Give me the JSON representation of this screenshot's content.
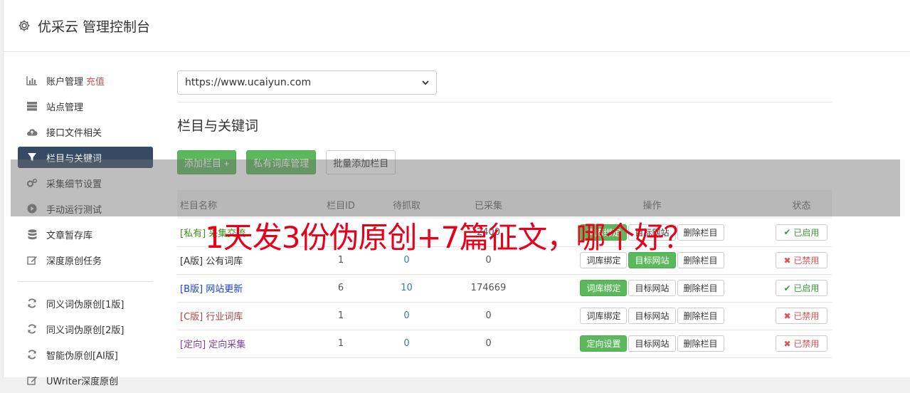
{
  "header": {
    "title": "优采云 管理控制台"
  },
  "sidebar": {
    "items": [
      {
        "label": "账户管理",
        "extra": "充值",
        "icon": "bar-chart-icon"
      },
      {
        "label": "站点管理",
        "icon": "server-icon"
      },
      {
        "label": "接口文件相关",
        "icon": "cloud-upload-icon"
      },
      {
        "label": "栏目与关键词",
        "icon": "filter-icon",
        "active": true
      },
      {
        "label": "采集细节设置",
        "icon": "cogs-icon"
      },
      {
        "label": "手动运行测试",
        "icon": "play-icon"
      },
      {
        "label": "文章暂存库",
        "icon": "database-icon"
      },
      {
        "label": "深度原创任务",
        "icon": "edit-icon"
      }
    ],
    "items2": [
      {
        "label": "同义词伪原创[1版]",
        "icon": "refresh-icon"
      },
      {
        "label": "同义词伪原创[2版]",
        "icon": "refresh-icon"
      },
      {
        "label": "智能伪原创[AI版]",
        "icon": "refresh-icon"
      },
      {
        "label": "UWriter深度原创",
        "icon": "edit-icon"
      }
    ]
  },
  "main": {
    "site_select": "https://www.ucaiyun.com",
    "section_title": "栏目与关键词",
    "buttons": {
      "add": "添加栏目 +",
      "private": "私有词库管理",
      "batch": "批量添加栏目"
    },
    "table": {
      "headers": [
        "栏目名称",
        "栏目ID",
        "待抓取",
        "已采集",
        "操作",
        "状态"
      ],
      "rows": [
        {
          "tag": "[私有]",
          "name": "采集交流",
          "id": "",
          "pending": "",
          "collected": "2400",
          "btn1": "词库绑定",
          "btn2": "目标网站",
          "btn3": "删除栏目",
          "status": "已启用"
        },
        {
          "tag": "[A版]",
          "name": "公有词库",
          "id": "1",
          "pending": "0",
          "collected": "0",
          "btn1": "词库绑定",
          "btn2": "目标网站",
          "btn3": "删除栏目",
          "status": "已禁用"
        },
        {
          "tag": "[B版]",
          "name": "网站更新",
          "id": "6",
          "pending": "10",
          "collected": "174669",
          "btn1": "词库绑定",
          "btn2": "目标网站",
          "btn3": "删除栏目",
          "status": "已启用"
        },
        {
          "tag": "[C版]",
          "name": "行业词库",
          "id": "1",
          "pending": "0",
          "collected": "0",
          "btn1": "词库绑定",
          "btn2": "目标网站",
          "btn3": "删除栏目",
          "status": "已禁用"
        },
        {
          "tag": "[定向]",
          "name": "定向采集",
          "id": "1",
          "pending": "0",
          "collected": "0",
          "btn1": "定向设置",
          "btn2": "目标网站",
          "btn3": "删除栏目",
          "status": "已禁用"
        }
      ]
    }
  },
  "overlay": {
    "text": "1天发3份伪原创+7篇征文，哪个好？"
  },
  "colors": {
    "accent": "#354a64",
    "green": "#5cb85c",
    "red": "#d9534f",
    "overlay_text": "#e8001a"
  }
}
